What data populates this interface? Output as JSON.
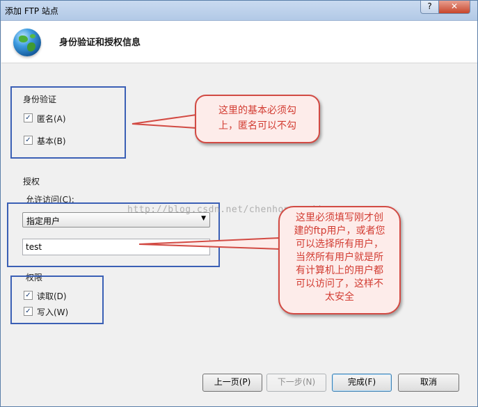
{
  "window": {
    "title": "添加 FTP 站点",
    "help_label": "?",
    "close_label": "✕"
  },
  "header": {
    "title": "身份验证和授权信息",
    "icon": "globe-icon"
  },
  "authentication": {
    "title": "身份验证",
    "options": [
      {
        "label": "匿名(A)",
        "checked": true
      },
      {
        "label": "基本(B)",
        "checked": true
      }
    ]
  },
  "authorization": {
    "title": "授权",
    "allow_label": "允许访问(C):",
    "select_value": "指定用户",
    "user_input": "test"
  },
  "permissions": {
    "title": "权限",
    "options": [
      {
        "label": "读取(D)",
        "checked": true
      },
      {
        "label": "写入(W)",
        "checked": true
      }
    ]
  },
  "footer": {
    "prev": "上一页(P)",
    "next": "下一步(N)",
    "finish": "完成(F)",
    "cancel": "取消"
  },
  "annotations": {
    "callout1_line1": "这里的基本必须勾",
    "callout1_line2": "上，匿名可以不勾",
    "callout2_lines": [
      "这里必须填写刚才创",
      "建的ftp用户，或者您",
      "可以选择所有用户，",
      "当然所有用户就是所",
      "有计算机上的用户都",
      "可以访问了，这样不",
      "太安全"
    ],
    "watermark": "http://blog.csdn.net/chenhongwunbb",
    "frame_color": "#3a5fb5",
    "callout_color": "#d24a43"
  }
}
